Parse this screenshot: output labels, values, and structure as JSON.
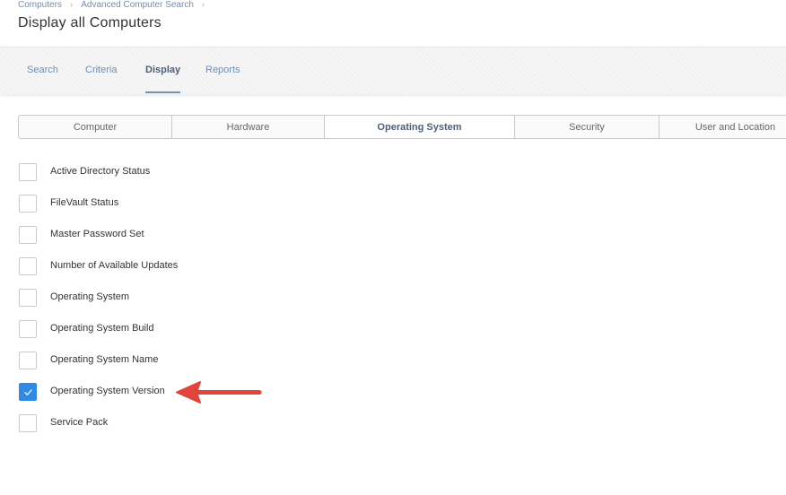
{
  "breadcrumb": {
    "items": [
      "Computers",
      "Advanced Computer Search"
    ]
  },
  "page": {
    "title": "Display all Computers"
  },
  "tabs": [
    {
      "label": "Search",
      "active": false
    },
    {
      "label": "Criteria",
      "active": false
    },
    {
      "label": "Display",
      "active": true
    },
    {
      "label": "Reports",
      "active": false
    }
  ],
  "categories": [
    {
      "label": "Computer",
      "active": false
    },
    {
      "label": "Hardware",
      "active": false
    },
    {
      "label": "Operating System",
      "active": true
    },
    {
      "label": "Security",
      "active": false
    },
    {
      "label": "User and Location",
      "active": false
    }
  ],
  "options": [
    {
      "label": "Active Directory Status",
      "checked": false
    },
    {
      "label": "FileVault Status",
      "checked": false
    },
    {
      "label": "Master Password Set",
      "checked": false
    },
    {
      "label": "Number of Available Updates",
      "checked": false
    },
    {
      "label": "Operating System",
      "checked": false
    },
    {
      "label": "Operating System Build",
      "checked": false
    },
    {
      "label": "Operating System Name",
      "checked": false
    },
    {
      "label": "Operating System Version",
      "checked": true
    },
    {
      "label": "Service Pack",
      "checked": false
    }
  ],
  "colors": {
    "accent": "#2f8ae5",
    "link": "#6f8fb3",
    "annotation_arrow": "#e0443b"
  },
  "icons": {
    "check": "checkmark-icon",
    "breadcrumb_separator": "chevron-right-icon",
    "annotation": "arrow-left-icon"
  }
}
